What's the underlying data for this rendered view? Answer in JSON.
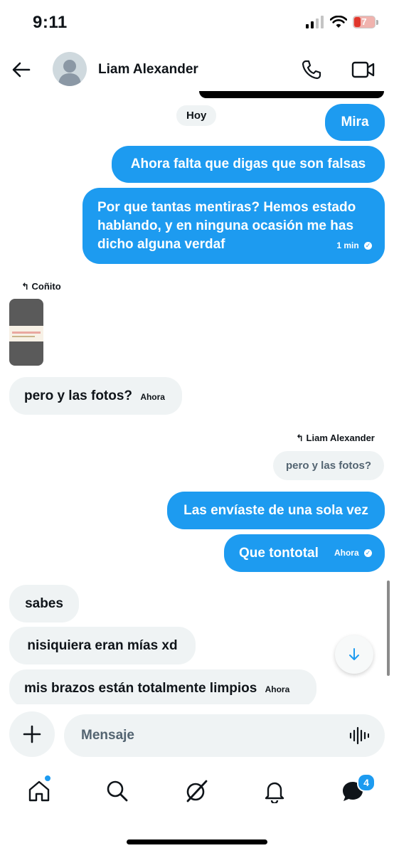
{
  "status_bar": {
    "time": "9:11",
    "battery": "7"
  },
  "header": {
    "contact_name": "Liam Alexander"
  },
  "chat": {
    "day_label": "Hoy",
    "outgoing": {
      "mira": "Mira",
      "falsas": "Ahora falta que digas que son falsas",
      "mentiras": "Por que tantas mentiras? Hemos estado hablando, y en ninguna ocasión me has dicho alguna verdaf",
      "mentiras_time": "1 min",
      "enviaste": "Las envíaste de una sola vez",
      "tontotal": "Que tontotal",
      "tontotal_time": "Ahora"
    },
    "reply_incoming": {
      "label": "Coñito"
    },
    "incoming": {
      "fotos": "pero y las fotos?",
      "fotos_time": "Ahora",
      "sabes": "sabes",
      "nisiquiera": "nisiquiera eran mías xd",
      "brazos": "mis brazos están totalmente limpios",
      "brazos_time": "Ahora"
    },
    "reply_outgoing": {
      "label": "Liam Alexander",
      "quoted": "pero y las fotos?"
    }
  },
  "composer": {
    "placeholder": "Mensaje"
  },
  "nav": {
    "messages_badge": "4"
  },
  "colors": {
    "accent": "#1d9bf0",
    "bubble_in": "#eff3f4"
  }
}
